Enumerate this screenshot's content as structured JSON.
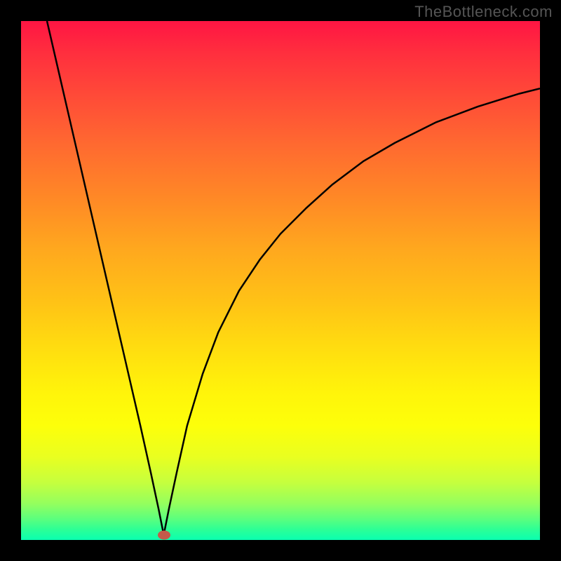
{
  "watermark": "TheBottleneck.com",
  "chart_data": {
    "type": "line",
    "title": "",
    "xlabel": "",
    "ylabel": "",
    "xlim": [
      0,
      100
    ],
    "ylim": [
      0,
      100
    ],
    "marker": {
      "x": 27.5,
      "y": 1
    },
    "series": [
      {
        "name": "curve",
        "x": [
          5,
          8,
          11,
          14,
          17,
          20,
          23,
          25,
          26.5,
          27.5,
          28.5,
          30,
          32,
          35,
          38,
          42,
          46,
          50,
          55,
          60,
          66,
          72,
          80,
          88,
          96,
          100
        ],
        "y": [
          100,
          87,
          74,
          61,
          48,
          35,
          22,
          13,
          6,
          1,
          6,
          13,
          22,
          32,
          40,
          48,
          54,
          59,
          64,
          68.5,
          73,
          76.5,
          80.5,
          83.5,
          86,
          87
        ]
      }
    ]
  }
}
